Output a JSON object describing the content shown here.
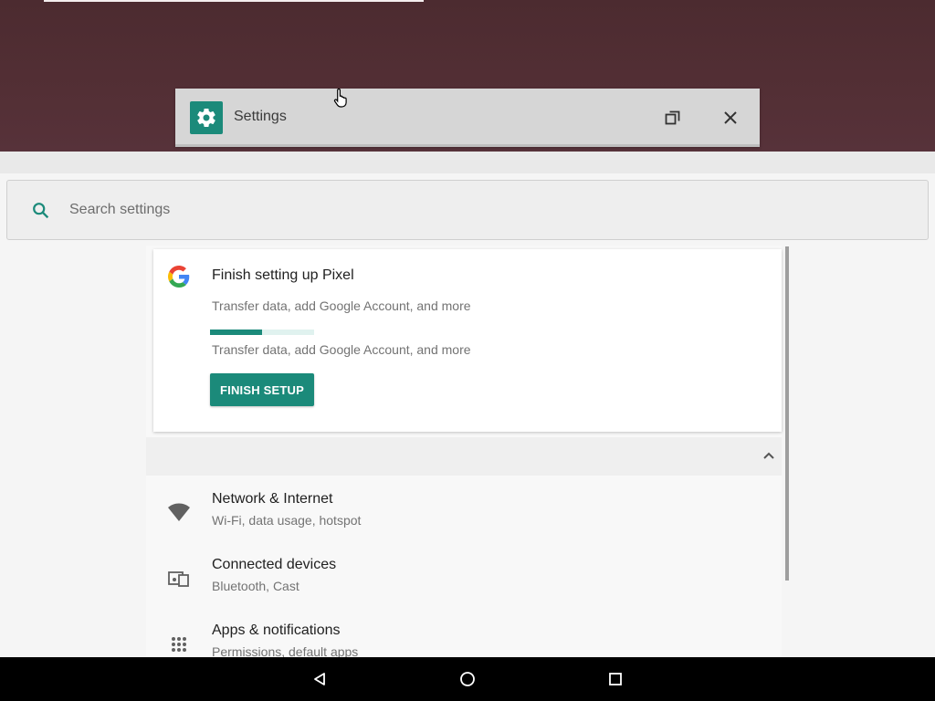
{
  "window": {
    "title": "Settings"
  },
  "search": {
    "placeholder": "Search settings"
  },
  "suggestion_card": {
    "title": "Finish setting up Pixel",
    "subtitle": "Transfer data, add Google Account, and more",
    "progress_subtitle": "Transfer data, add Google Account, and more",
    "progress_percent": 50,
    "button_label": "FINISH SETUP"
  },
  "settings_list": [
    {
      "title": "Network & Internet",
      "subtitle": "Wi-Fi, data usage, hotspot",
      "icon": "wifi-icon"
    },
    {
      "title": "Connected devices",
      "subtitle": "Bluetooth, Cast",
      "icon": "devices-icon"
    },
    {
      "title": "Apps & notifications",
      "subtitle": "Permissions, default apps",
      "icon": "apps-grid-icon"
    }
  ],
  "colors": {
    "accent": "#1b8a7a",
    "wallpaper": "#4c2b30",
    "navbar": "#000000"
  },
  "navigation": {
    "buttons": [
      "back-icon",
      "home-icon",
      "recents-icon"
    ]
  }
}
